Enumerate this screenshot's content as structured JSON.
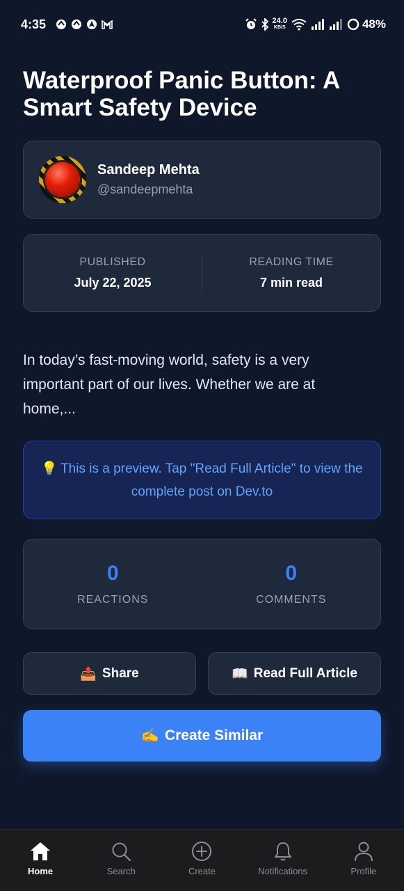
{
  "status_bar": {
    "time": "4:35",
    "speed_value": "24.0",
    "speed_unit": "KB/S",
    "battery": "48%"
  },
  "article": {
    "title": "Waterproof Panic Button: A Smart Safety Device",
    "author_name": "Sandeep Mehta",
    "author_handle": "@sandeepmehta",
    "published_label": "PUBLISHED",
    "published_value": "July 22, 2025",
    "reading_label": "READING TIME",
    "reading_value": "7 min read",
    "excerpt": "In today’s fast-moving world, safety is a very important part of our lives. Whether we are at home,...",
    "preview_note": "This is a preview. Tap \"Read Full Article\" to view the complete post on Dev.to",
    "preview_icon": "💡"
  },
  "stats": {
    "reactions_value": "0",
    "reactions_label": "REACTIONS",
    "comments_value": "0",
    "comments_label": "COMMENTS"
  },
  "actions": {
    "share_icon": "📤",
    "share_label": "Share",
    "read_icon": "📖",
    "read_label": "Read Full Article",
    "create_icon": "✍️",
    "create_label": "Create Similar"
  },
  "nav": {
    "home": "Home",
    "search": "Search",
    "create": "Create",
    "notifications": "Notifications",
    "profile": "Profile"
  },
  "colors": {
    "background": "#0f172a",
    "card": "#1e293b",
    "accent": "#3b82f6",
    "preview_text": "#60a5fa"
  }
}
